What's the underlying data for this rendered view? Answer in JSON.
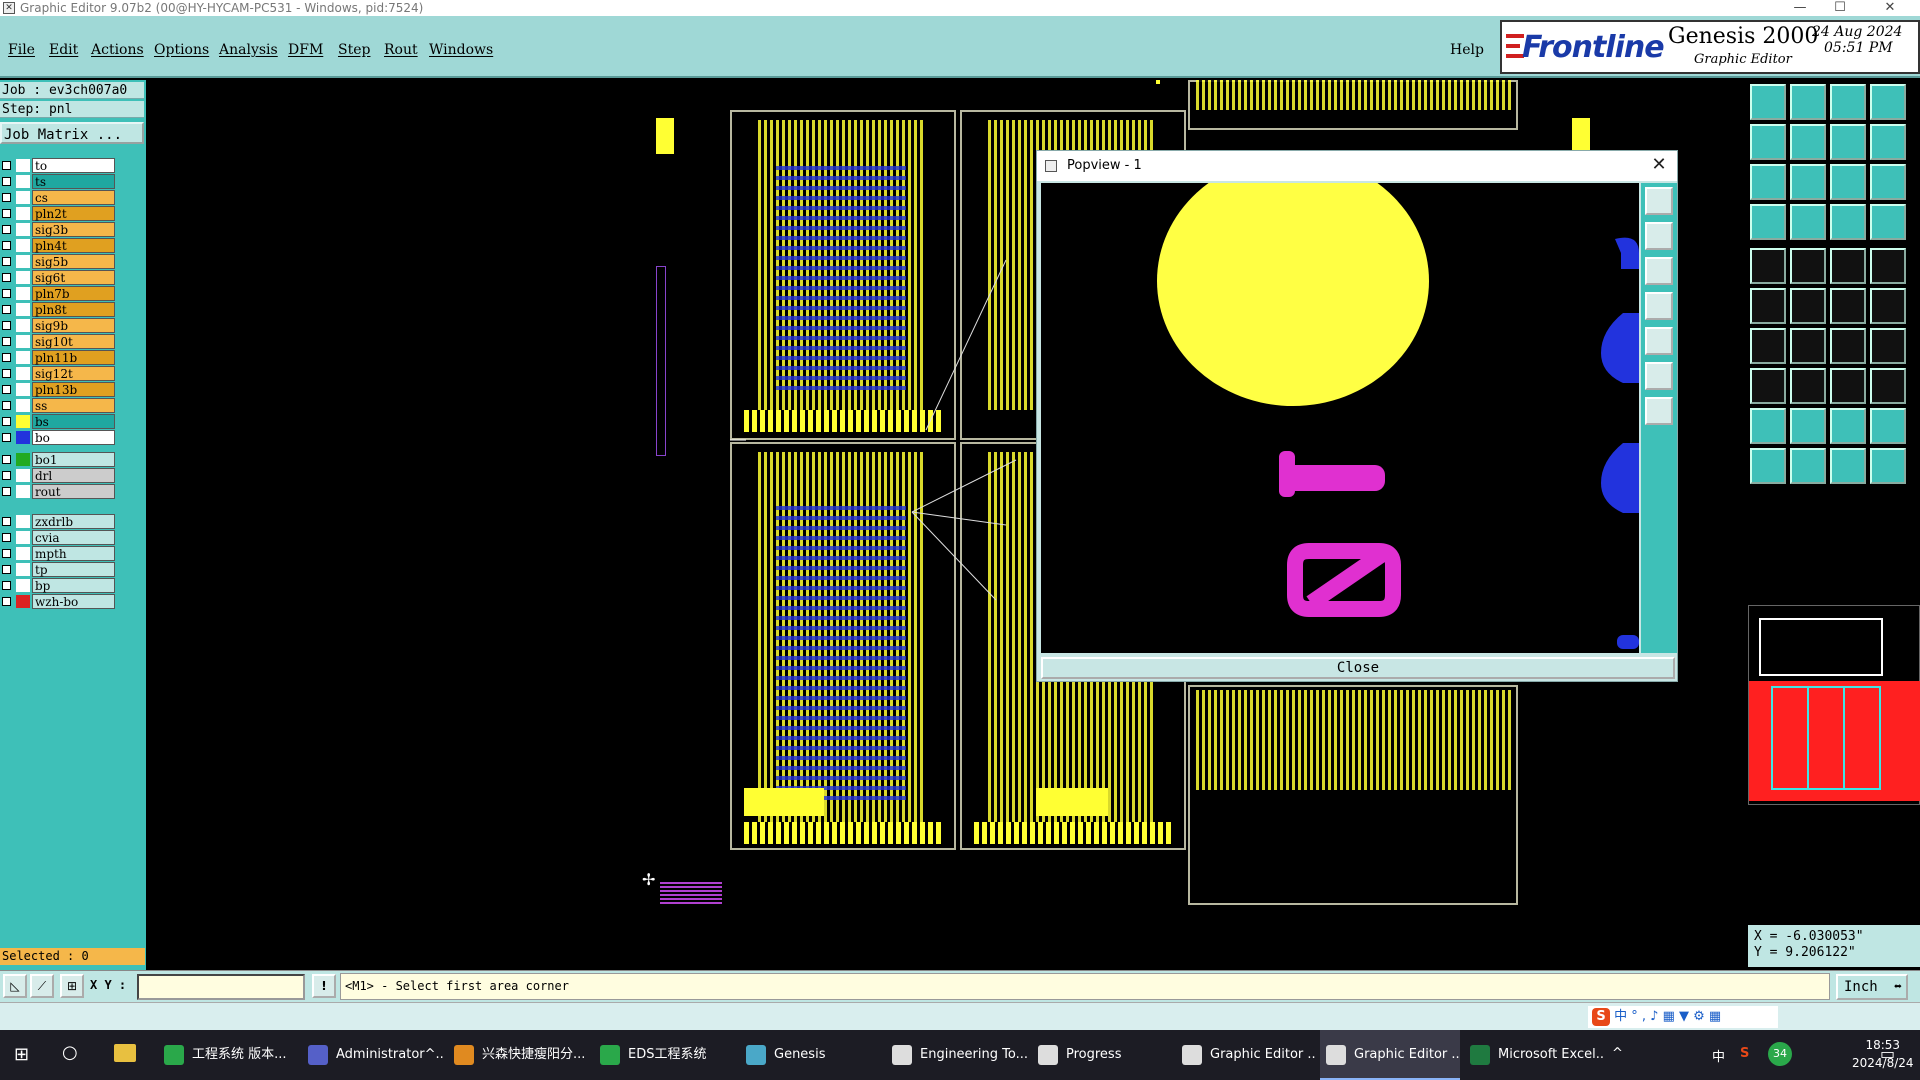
{
  "window": {
    "title": "Graphic Editor 9.07b2 (00@HY-HYCAM-PC531 - Windows, pid:7524)"
  },
  "menu": [
    "File",
    "Edit",
    "Actions",
    "Options",
    "Analysis",
    "DFM",
    "Step",
    "Rout",
    "Windows"
  ],
  "help_label": "Help",
  "brand": {
    "logo": "Frontline",
    "product": "Genesis 2000",
    "subtitle": "Graphic Editor",
    "date": "24 Aug 2024",
    "time": "05:51 PM"
  },
  "left": {
    "job": "Job : ev3ch007a0",
    "step": "Step: pnl",
    "job_matrix": "Job Matrix ...",
    "layers": [
      {
        "name": "to",
        "color": "#ffffff",
        "swatch": "#ffffff"
      },
      {
        "name": "ts",
        "color": "#1fa8a0",
        "swatch": "#ffffff"
      },
      {
        "name": "cs",
        "color": "#f5b74a",
        "swatch": "#ffffff"
      },
      {
        "name": "pln2t",
        "color": "#e0a020",
        "swatch": "#ffffff"
      },
      {
        "name": "sig3b",
        "color": "#f5b74a",
        "swatch": "#ffffff"
      },
      {
        "name": "pln4t",
        "color": "#e0a020",
        "swatch": "#ffffff"
      },
      {
        "name": "sig5b",
        "color": "#f5b74a",
        "swatch": "#ffffff"
      },
      {
        "name": "sig6t",
        "color": "#f5b74a",
        "swatch": "#ffffff"
      },
      {
        "name": "pln7b",
        "color": "#e0a020",
        "swatch": "#ffffff"
      },
      {
        "name": "pln8t",
        "color": "#e0a020",
        "swatch": "#ffffff"
      },
      {
        "name": "sig9b",
        "color": "#f5b74a",
        "swatch": "#ffffff"
      },
      {
        "name": "sig10t",
        "color": "#f5b74a",
        "swatch": "#ffffff"
      },
      {
        "name": "pln11b",
        "color": "#e0a020",
        "swatch": "#ffffff"
      },
      {
        "name": "sig12t",
        "color": "#f5b74a",
        "swatch": "#ffffff"
      },
      {
        "name": "pln13b",
        "color": "#e0a020",
        "swatch": "#ffffff"
      },
      {
        "name": "ss",
        "color": "#f5b74a",
        "swatch": "#ffffff"
      },
      {
        "name": "bs",
        "color": "#1fa8a0",
        "swatch": "#ffff33"
      },
      {
        "name": "bo",
        "color": "#ffffff",
        "swatch": "#2233dd"
      }
    ],
    "layers2": [
      {
        "name": "bo1",
        "color": "#bfe6e3",
        "swatch": "#22aa22"
      },
      {
        "name": "drl",
        "color": "#cccccc",
        "swatch": "#ffffff"
      },
      {
        "name": "rout",
        "color": "#cccccc",
        "swatch": "#ffffff"
      }
    ],
    "layers3": [
      {
        "name": "zxdrlb",
        "color": "#bfe6e3",
        "swatch": "#ffffff"
      },
      {
        "name": "cvia",
        "color": "#bfe6e3",
        "swatch": "#ffffff"
      },
      {
        "name": "mpth",
        "color": "#bfe6e3",
        "swatch": "#ffffff"
      },
      {
        "name": "tp",
        "color": "#bfe6e3",
        "swatch": "#ffffff"
      },
      {
        "name": "bp",
        "color": "#bfe6e3",
        "swatch": "#ffffff"
      },
      {
        "name": "wzh-bo",
        "color": "#bfe6e3",
        "swatch": "#dd2222"
      }
    ],
    "selected": "Selected : 0"
  },
  "popup": {
    "title": "Popview - 1",
    "close_label": "Close"
  },
  "coords": {
    "x": "X = -6.030053\"",
    "y": "Y = 9.206122\""
  },
  "bottom": {
    "xy_label": "X Y :",
    "xy_value": "",
    "prompt": "<M1> - Select first area corner",
    "unit": "Inch"
  },
  "ime": "中 ° , ♪ ▦ ▼ ⚙ ▦",
  "taskbar": {
    "items": [
      {
        "label": "工程系统  版本...",
        "color": "#2aa84a"
      },
      {
        "label": "Administrator^...",
        "color": "#5560c8"
      },
      {
        "label": "兴森快捷瘦阳分...",
        "color": "#e08a20"
      },
      {
        "label": "EDS工程系统",
        "color": "#2aa84a"
      },
      {
        "label": "Genesis",
        "color": "#4aa8c8"
      },
      {
        "label": "Engineering To...",
        "color": "#dddddd"
      },
      {
        "label": "Progress",
        "color": "#dddddd"
      },
      {
        "label": "Graphic Editor ...",
        "color": "#dddddd"
      },
      {
        "label": "Graphic Editor ...",
        "color": "#dddddd"
      },
      {
        "label": "Microsoft Excel...",
        "color": "#1f7a40"
      }
    ],
    "clock_time": "18:53",
    "clock_date": "2024/8/24",
    "tray": [
      "^",
      "中",
      "S",
      "34"
    ]
  }
}
